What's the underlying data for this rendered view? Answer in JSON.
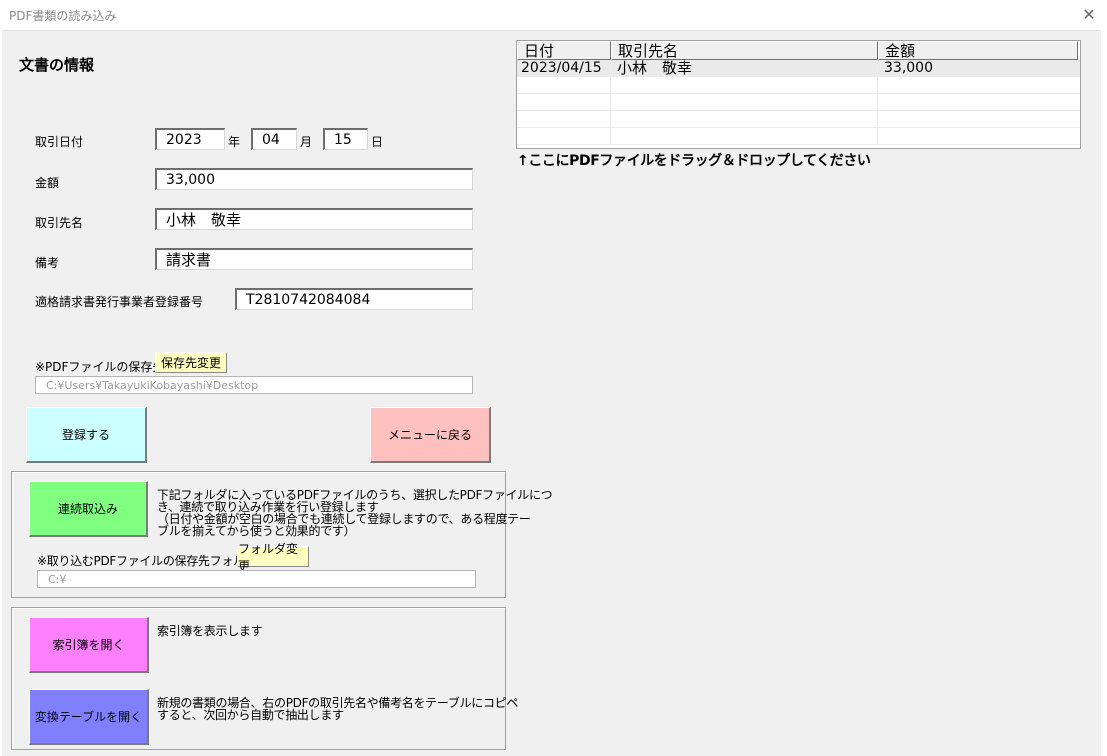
{
  "window": {
    "title": "PDF書類の読み込み",
    "close_icon": "close-icon"
  },
  "form": {
    "heading": "文書の情報",
    "date_label": "取引日付",
    "year": "2023",
    "year_unit": "年",
    "month": "04",
    "month_unit": "月",
    "day": "15",
    "day_unit": "日",
    "amount_label": "金額",
    "amount": "33,000",
    "partner_label": "取引先名",
    "partner": "小林　敬幸",
    "note_label": "備考",
    "note": "請求書",
    "reg_label": "適格請求書発行事業者登録番号",
    "reg_number": "T2810742084084",
    "save_label": "※PDFファイルの保存先",
    "change_save_button": "保存先変更",
    "save_path": "C:¥Users¥TakayukiKobayashi¥Desktop",
    "register_button": "登録する",
    "menu_button": "メニューに戻る"
  },
  "batch": {
    "button": "連続取込み",
    "desc": [
      "下記フォルダに入っているPDFファイルのうち、選択したPDFファイルにつ",
      "き、連続で取り込み作業を行い登録します",
      "（日付や金額が空白の場合でも連続して登録しますので、ある程度テー",
      "ブルを揃えてから使うと効果的です）"
    ],
    "folder_label": "※取り込むPDFファイルの保存先フォルダ",
    "folder_button": "フォルダ変更",
    "folder_path": "C:¥"
  },
  "tools": {
    "index_button": "索引簿を開く",
    "index_desc": "索引簿を表示します",
    "table_button": "変換テーブルを開く",
    "table_desc": [
      "新規の書類の場合、右のPDFの取引先名や備考名をテーブルにコピペ",
      "すると、次回から自動で抽出します"
    ]
  },
  "list": {
    "columns": [
      "日付",
      "取引先名",
      "金額"
    ],
    "rows": [
      [
        "2023/04/15",
        "小林　敬幸",
        "33,000"
      ],
      [
        "",
        "",
        ""
      ],
      [
        "",
        "",
        ""
      ],
      [
        "",
        "",
        ""
      ],
      [
        "",
        "",
        ""
      ]
    ],
    "drop_hint": "↑ここにPDFファイルをドラッグ＆ドロップしてください"
  },
  "colors": {
    "register": "#ccffff",
    "menu": "#ffc0c0",
    "batch": "#80ff80",
    "index": "#ff80ff",
    "table": "#8080ff",
    "small_button": "#ffffc0"
  }
}
